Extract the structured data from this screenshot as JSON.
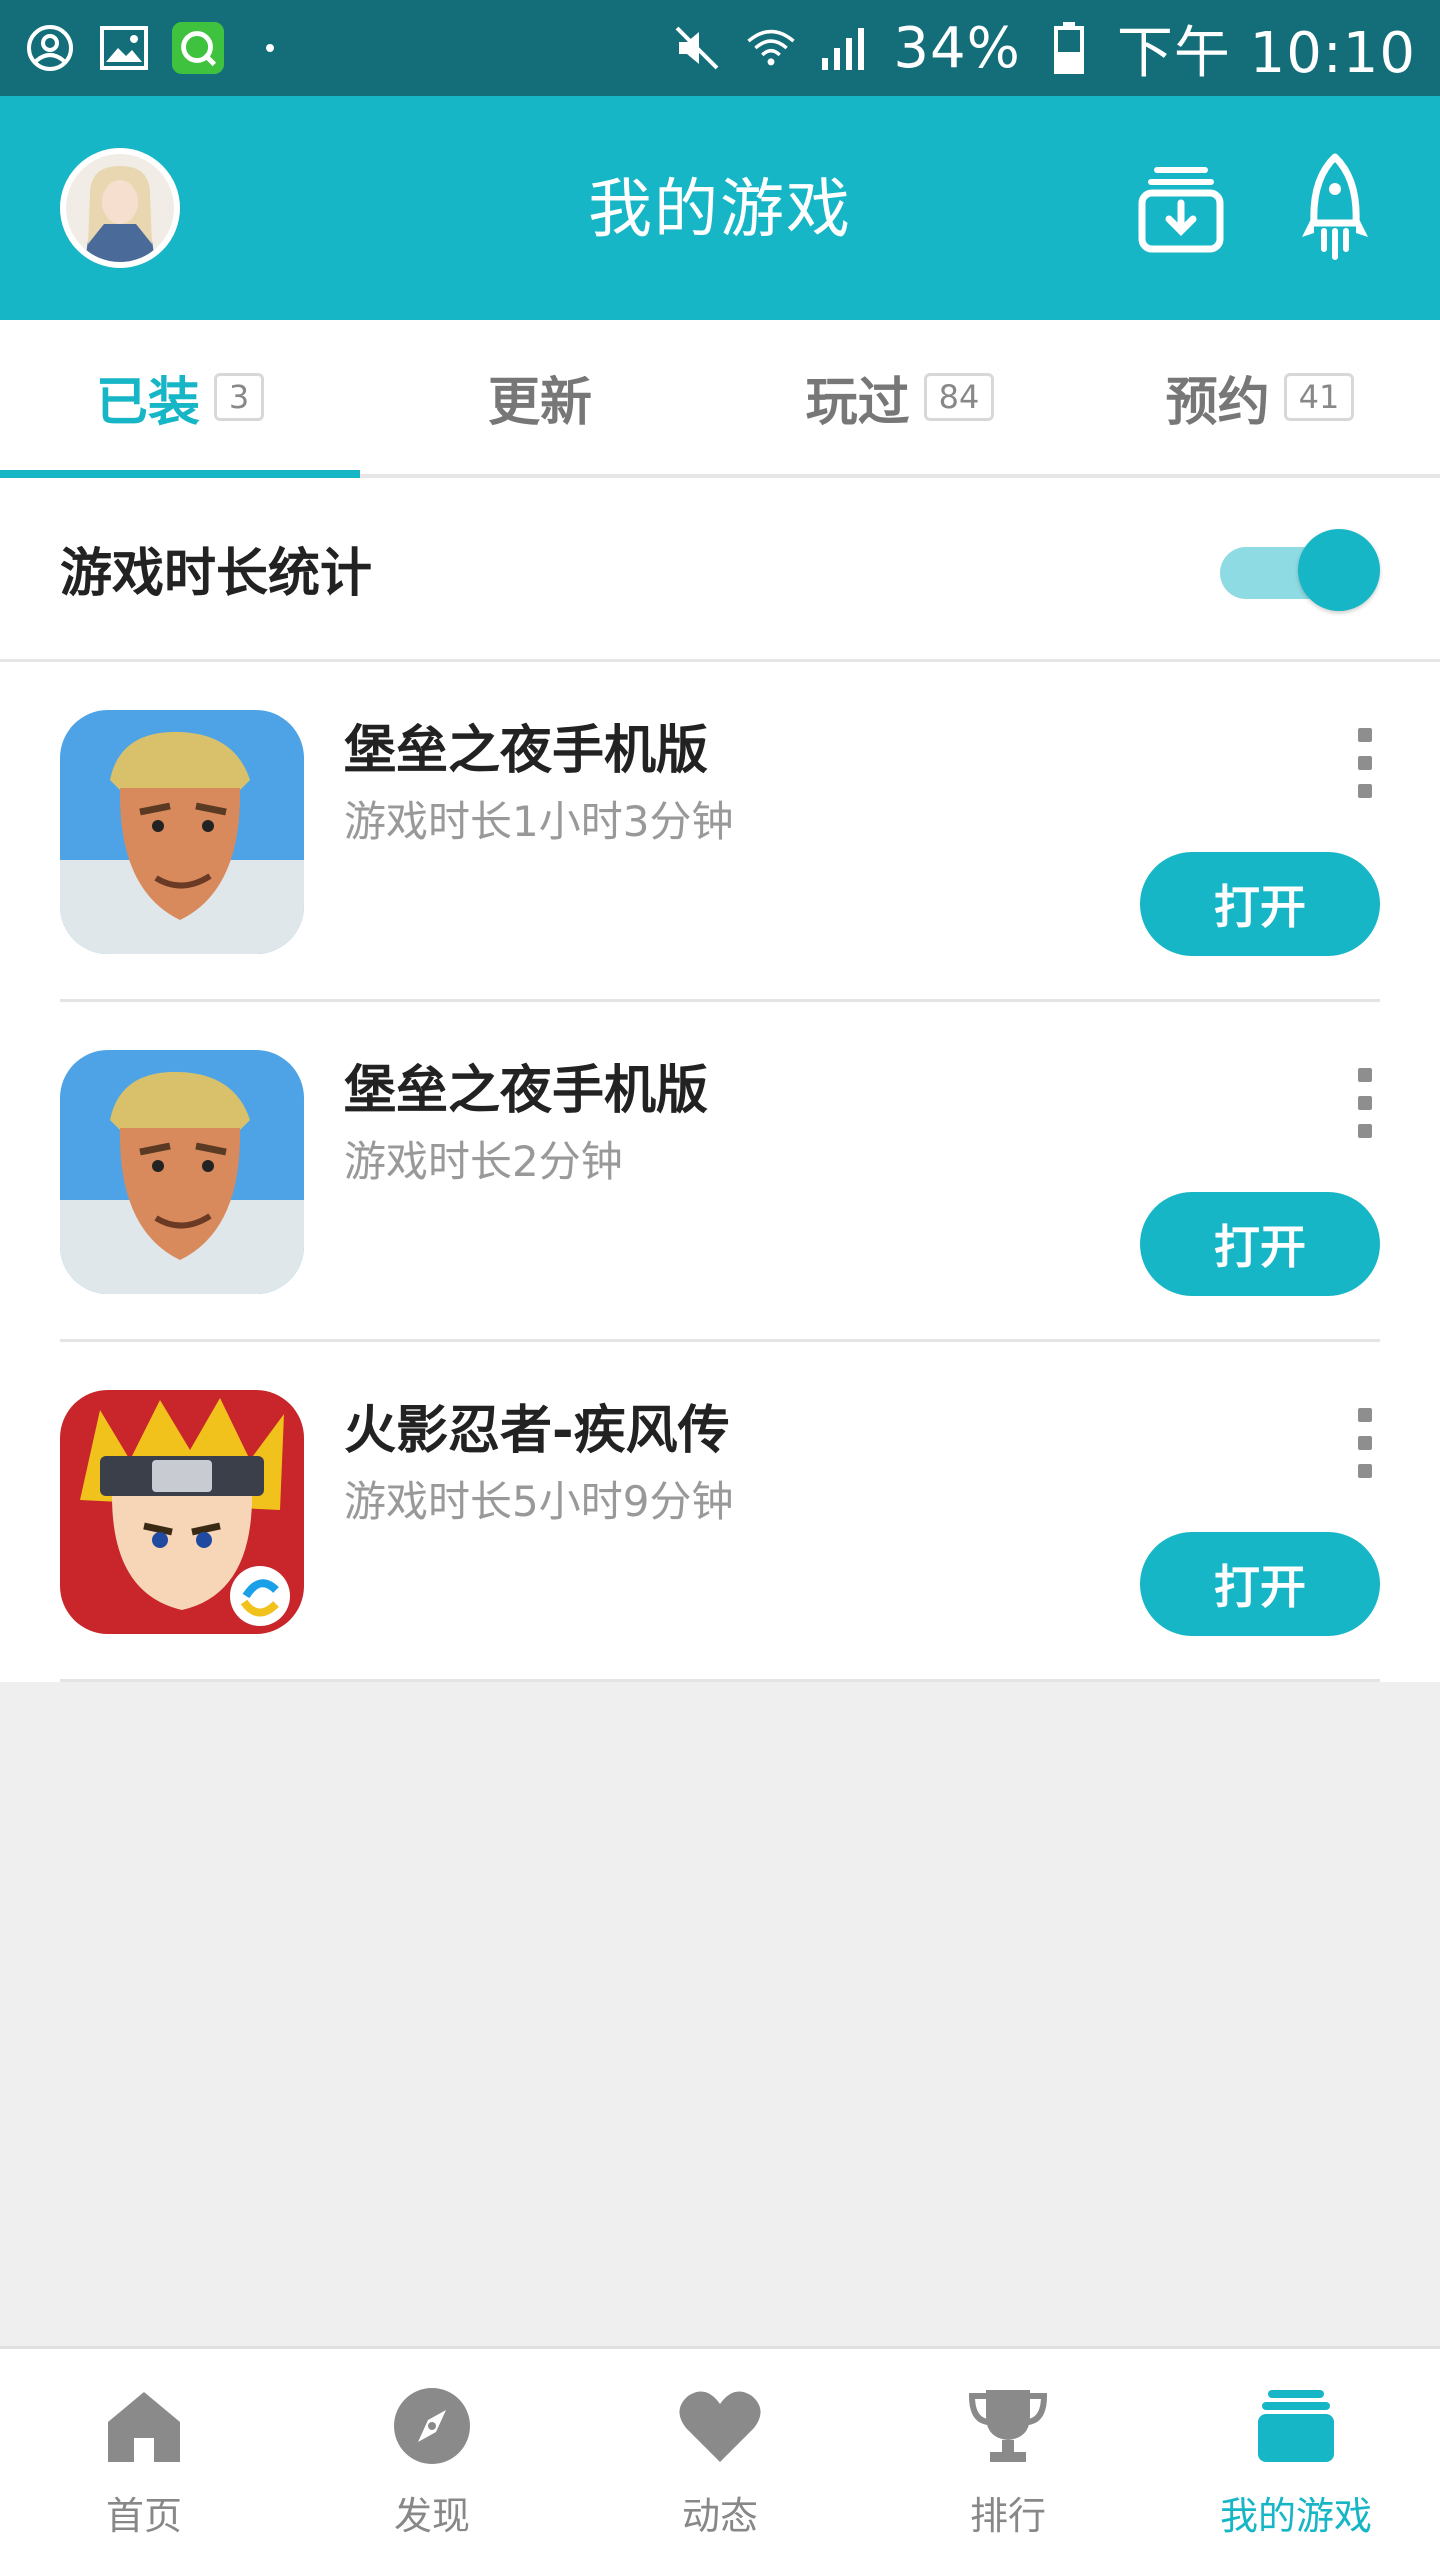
{
  "status_bar": {
    "battery": "34%",
    "time": "下午 10:10",
    "icons": [
      "account-circle-icon",
      "gallery-icon",
      "wechat-like-app-icon",
      "mute-icon",
      "wifi-icon",
      "signal-icon",
      "battery-icon"
    ]
  },
  "app_bar": {
    "title": "我的游戏",
    "left": "avatar",
    "actions": [
      "download-box-icon",
      "rocket-icon"
    ]
  },
  "tabs": [
    {
      "label": "已装",
      "badge": "3",
      "active": true
    },
    {
      "label": "更新",
      "badge": "",
      "active": false
    },
    {
      "label": "玩过",
      "badge": "84",
      "active": false
    },
    {
      "label": "预约",
      "badge": "41",
      "active": false
    }
  ],
  "stats_toggle": {
    "label": "游戏时长统计",
    "on": true
  },
  "games": [
    {
      "name": "堡垒之夜手机版",
      "playtime": "游戏时长1小时3分钟",
      "button": "打开",
      "icon": "fortnite-icon"
    },
    {
      "name": "堡垒之夜手机版",
      "playtime": "游戏时长2分钟",
      "button": "打开",
      "icon": "fortnite-icon"
    },
    {
      "name": "火影忍者-疾风传",
      "playtime": "游戏时长5小时9分钟",
      "button": "打开",
      "icon": "naruto-icon"
    }
  ],
  "bottom_nav": [
    {
      "label": "首页",
      "icon": "home-icon",
      "active": false
    },
    {
      "label": "发现",
      "icon": "compass-icon",
      "active": false
    },
    {
      "label": "动态",
      "icon": "heart-icon",
      "active": false
    },
    {
      "label": "排行",
      "icon": "trophy-icon",
      "active": false
    },
    {
      "label": "我的游戏",
      "icon": "game-stack-icon",
      "active": true
    }
  ],
  "colors": {
    "primary": "#17b6c6",
    "status_bar": "#136e7a",
    "toggle_track": "#8fdbe3"
  }
}
